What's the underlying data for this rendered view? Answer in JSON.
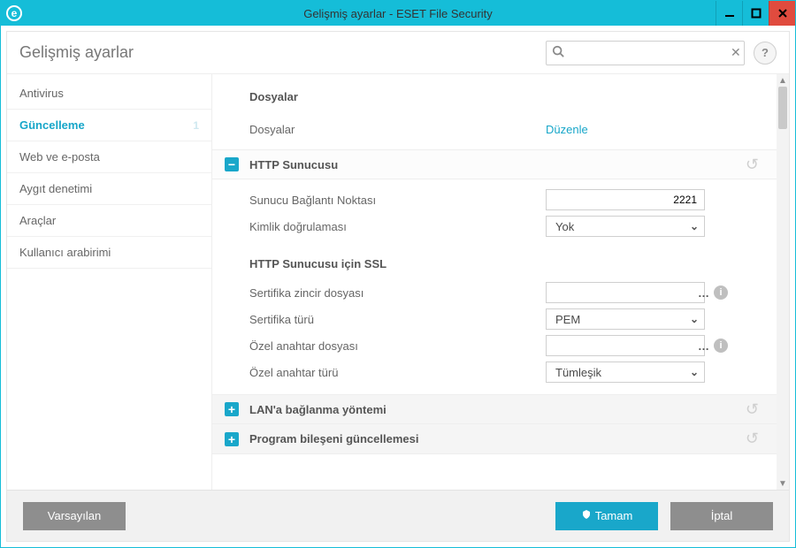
{
  "window": {
    "title": "Gelişmiş ayarlar - ESET File Security"
  },
  "topbar": {
    "title": "Gelişmiş ayarlar"
  },
  "search": {
    "placeholder": ""
  },
  "sidebar": {
    "items": [
      {
        "label": "Antivirus",
        "active": false
      },
      {
        "label": "Güncelleme",
        "active": true,
        "badge": "1"
      },
      {
        "label": "Web ve e-posta",
        "active": false
      },
      {
        "label": "Aygıt denetimi",
        "active": false
      },
      {
        "label": "Araçlar",
        "active": false
      },
      {
        "label": "Kullanıcı arabirimi",
        "active": false
      }
    ]
  },
  "content": {
    "files": {
      "title": "Dosyalar",
      "row_label": "Dosyalar",
      "row_action": "Düzenle"
    },
    "http": {
      "title": "HTTP Sunucusu",
      "port_label": "Sunucu Bağlantı Noktası",
      "port_value": "2221",
      "auth_label": "Kimlik doğrulaması",
      "auth_value": "Yok",
      "ssl": {
        "title": "HTTP Sunucusu için SSL",
        "chain_label": "Sertifika zincir dosyası",
        "chain_value": "",
        "cert_type_label": "Sertifika türü",
        "cert_type_value": "PEM",
        "pk_label": "Özel anahtar dosyası",
        "pk_value": "",
        "pk_type_label": "Özel anahtar türü",
        "pk_type_value": "Tümleşik"
      }
    },
    "lan": {
      "title": "LAN'a bağlanma yöntemi"
    },
    "pcu": {
      "title": "Program bileşeni güncellemesi"
    }
  },
  "footer": {
    "defaults": "Varsayılan",
    "ok": "Tamam",
    "cancel": "İptal"
  }
}
